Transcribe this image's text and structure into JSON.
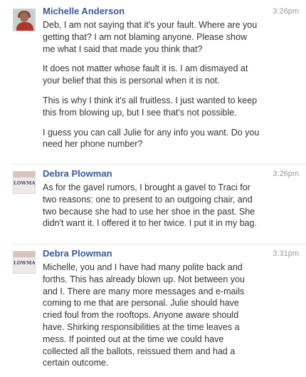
{
  "messages": [
    {
      "sender": "Michelle Anderson",
      "time": "3:26pm",
      "avatar": "profile-photo",
      "paragraphs": [
        "Deb, I am not saying that it's your fault. Where are you getting that? I am not blaming anyone. Please show me what I said that made you think that?",
        "It does not matter whose fault it is. I am dismayed at your belief that this is personal when it is not.",
        "This is why I think it's all fruitless. I just wanted to keep this from blowing up, but I see that's not possible.",
        "I guess you can call Julie for any info you want. Do you need her phone number?"
      ]
    },
    {
      "sender": "Debra Plowman",
      "time": "3:26pm",
      "avatar": "logo",
      "avatar_text": "LOWMA",
      "paragraphs": [
        "As for the gavel rumors, I brought a gavel to Traci for two reasons: one to present to an outgoing chair, and two because she had to use her shoe in the past. She didn't want it. I offered it to her twice. I put it in my bag."
      ]
    },
    {
      "sender": "Debra Plowman",
      "time": "3:31pm",
      "avatar": "logo",
      "avatar_text": "LOWMA",
      "paragraphs": [
        "Michelle, you and I have had many polite back and forths. This has already blown up. Not between you and I. There are many more messages and e-mails coming to me that are personal. Julie should have cried foul from the rooftops. Anyone aware should have. Shirking responsibilities at the time leaves a mess. If pointed out at the time we could have collected all the ballots, reissued them and had a certain outcome."
      ]
    }
  ],
  "colors": {
    "sender_link": "#3b5998",
    "timestamp": "#999999",
    "body_text": "#333333",
    "divider": "#e5e7ec"
  }
}
